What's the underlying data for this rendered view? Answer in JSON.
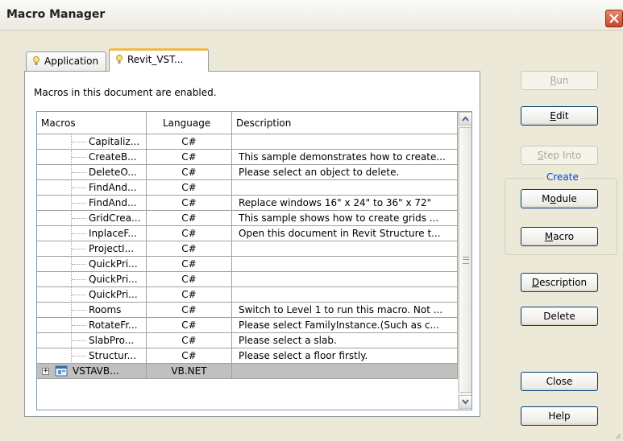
{
  "window": {
    "title": "Macro Manager"
  },
  "tabs": [
    {
      "label": "Application"
    },
    {
      "label": "Revit_VST..."
    }
  ],
  "status_text": "Macros in this document are enabled.",
  "grid": {
    "columns": [
      "Macros",
      "Language",
      "Description"
    ],
    "rows": [
      {
        "name": "Capitaliz...",
        "language": "C#",
        "description": ""
      },
      {
        "name": "CreateB...",
        "language": "C#",
        "description": "This sample demonstrates how to create..."
      },
      {
        "name": "DeleteO...",
        "language": "C#",
        "description": "Please select an object to delete."
      },
      {
        "name": "FindAnd...",
        "language": "C#",
        "description": ""
      },
      {
        "name": "FindAnd...",
        "language": "C#",
        "description": "Replace windows 16\" x 24\" to 36\" x 72\""
      },
      {
        "name": "GridCrea...",
        "language": "C#",
        "description": "This sample shows how to create grids ..."
      },
      {
        "name": "InplaceF...",
        "language": "C#",
        "description": "Open this document in Revit Structure t..."
      },
      {
        "name": "ProjectI...",
        "language": "C#",
        "description": ""
      },
      {
        "name": "QuickPri...",
        "language": "C#",
        "description": ""
      },
      {
        "name": "QuickPri...",
        "language": "C#",
        "description": ""
      },
      {
        "name": "QuickPri...",
        "language": "C#",
        "description": ""
      },
      {
        "name": "Rooms",
        "language": "C#",
        "description": "Switch to Level 1 to run this macro. Not ..."
      },
      {
        "name": "RotateFr...",
        "language": "C#",
        "description": "Please select FamilyInstance.(Such as c..."
      },
      {
        "name": "SlabPro...",
        "language": "C#",
        "description": "Please select a slab."
      },
      {
        "name": "Structur...",
        "language": "C#",
        "description": "Please select a floor firstly."
      }
    ],
    "project_row": {
      "name": "VSTAVB...",
      "language": "VB.NET",
      "description": ""
    }
  },
  "buttons": {
    "run": {
      "pre": "",
      "key": "R",
      "post": "un"
    },
    "edit": {
      "pre": "",
      "key": "E",
      "post": "dit"
    },
    "step_into": {
      "pre": "",
      "key": "S",
      "post": "tep Into"
    },
    "create_group": "Create",
    "module": {
      "pre": "M",
      "key": "o",
      "post": "dule"
    },
    "macro": {
      "pre": "",
      "key": "M",
      "post": "acro"
    },
    "description": {
      "pre": "",
      "key": "D",
      "post": "escription"
    },
    "delete": "Delete",
    "close": "Close",
    "help": "Help"
  }
}
